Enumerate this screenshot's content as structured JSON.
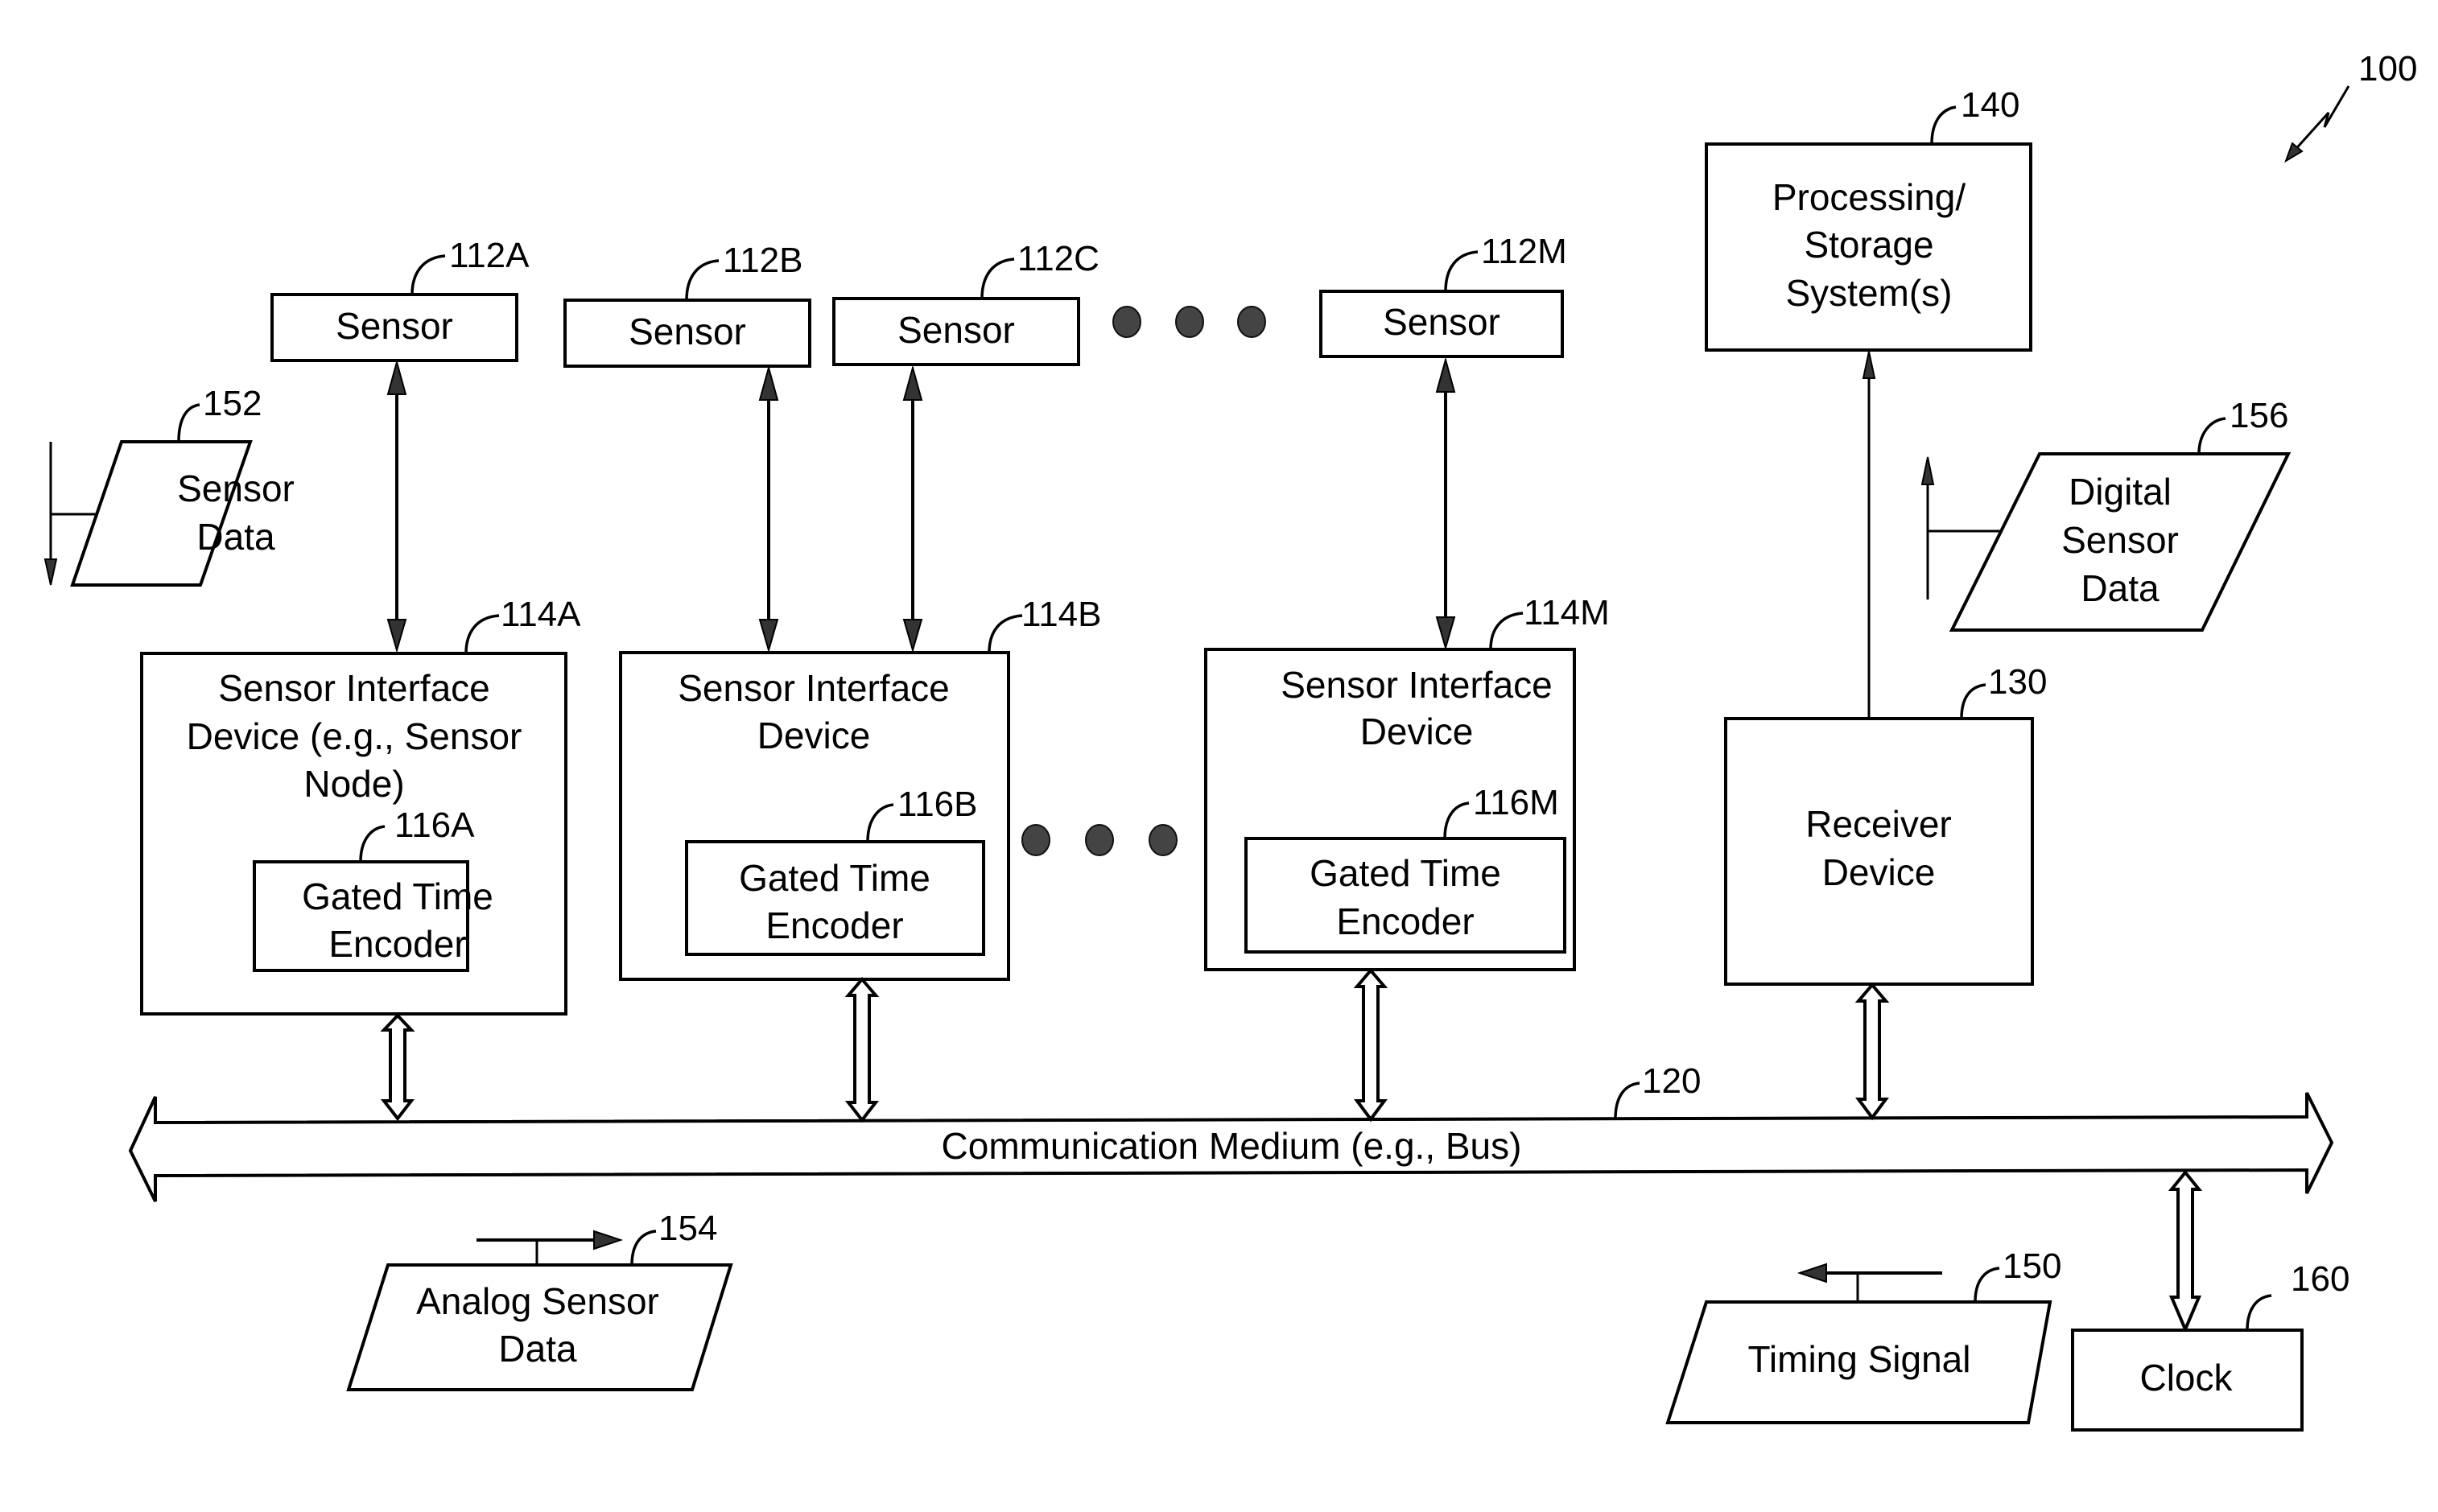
{
  "figure": {
    "ref": "100",
    "sensors": [
      {
        "ref": "112A",
        "label": "Sensor"
      },
      {
        "ref": "112B",
        "label": "Sensor"
      },
      {
        "ref": "112C",
        "label": "Sensor"
      },
      {
        "ref": "112M",
        "label": "Sensor"
      }
    ],
    "interfaces": [
      {
        "ref": "114A",
        "lines": [
          "Sensor Interface",
          "Device (e.g., Sensor",
          "Node)"
        ],
        "encoder": {
          "ref": "116A",
          "lines": [
            "Gated Time",
            "Encoder"
          ]
        }
      },
      {
        "ref": "114B",
        "lines": [
          "Sensor Interface",
          "Device"
        ],
        "encoder": {
          "ref": "116B",
          "lines": [
            "Gated Time",
            "Encoder"
          ]
        }
      },
      {
        "ref": "114M",
        "lines": [
          "Sensor Interface",
          "Device"
        ],
        "encoder": {
          "ref": "116M",
          "lines": [
            "Gated Time",
            "Encoder"
          ]
        }
      }
    ],
    "bus": {
      "ref": "120",
      "label": "Communication Medium (e.g., Bus)"
    },
    "receiver": {
      "ref": "130",
      "lines": [
        "Receiver",
        "Device"
      ]
    },
    "processing": {
      "ref": "140",
      "lines": [
        "Processing/",
        "Storage",
        "System(s)"
      ]
    },
    "sensor_data": {
      "ref": "152",
      "lines": [
        "Sensor",
        "Data"
      ]
    },
    "analog_data": {
      "ref": "154",
      "lines": [
        "Analog Sensor",
        "Data"
      ]
    },
    "digital_data": {
      "ref": "156",
      "lines": [
        "Digital",
        "Sensor",
        "Data"
      ]
    },
    "timing_signal": {
      "ref": "150",
      "lines": [
        "Timing Signal"
      ]
    },
    "clock": {
      "ref": "160",
      "lines": [
        "Clock"
      ]
    },
    "ellipsis_icon": "three-dots"
  }
}
